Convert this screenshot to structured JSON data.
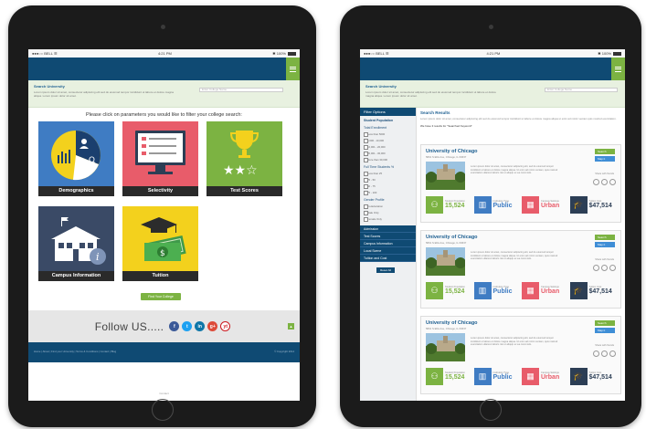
{
  "left": {
    "status": {
      "carrier": "●●●○○ BELL ☰",
      "time": "4:21 PM",
      "battery": "✱ 100%"
    },
    "search": {
      "title": "Search University",
      "desc": "Lorem ipsum dolor sit amet, consectetur adipiscing elit sed do eiusmod tempor incididunt ut labore et dolore magna aliqua. Lorem ipsum dolor sit amet.",
      "placeholder": "Enter College Name"
    },
    "instruction": "Please click on parameters you would like to filter your college search:",
    "tiles": [
      "Demographics",
      "Selectivity",
      "Test Scores",
      "Campus Information",
      "Tuition"
    ],
    "find_button": "Find Your College",
    "follow": {
      "label": "Follow US.....",
      "icons": [
        "f",
        "t",
        "in",
        "g+",
        "yt"
      ]
    },
    "footer": {
      "links": "Home | About | Find your University | Terms & Conditions | Contact | Blog",
      "copyright": "© Copyright 2014"
    },
    "page_end": "Contact"
  },
  "right": {
    "status": {
      "carrier": "●●●○○ BELL ☰",
      "time": "4:21 PM",
      "battery": "✱ 100%"
    },
    "search": {
      "title": "Search University",
      "desc": "Lorem ipsum dolor sit amet, consectetur adipiscing elit sed do eiusmod tempor incididunt ut labore et dolore magna aliqua. Lorem ipsum dolor sit amet.",
      "placeholder": "Enter College Name"
    },
    "sidebar": {
      "header": "Filter Options",
      "sections": [
        {
          "title": "Student Population",
          "options": []
        },
        {
          "title": "Total Enrollment",
          "options": [
            "Less than 5000",
            "5,000 - 10,000",
            "10,001 - 20,000",
            "20,001 - 30,000",
            "More than 30,000"
          ]
        },
        {
          "title": "Full Time Students %",
          "options": [
            "Less than 25",
            "25 - 50",
            "50 - 75",
            "75 - 100"
          ]
        },
        {
          "title": "Gender Profile",
          "options": [
            "Co-Education",
            "Male Only",
            "Female Only"
          ]
        }
      ],
      "collapsed": [
        "Admission",
        "Test Scores",
        "Campus Information",
        "Local Scene",
        "Tuition and Cost"
      ],
      "reset": "Reset All"
    },
    "results": {
      "title": "Search Results",
      "desc": "Lorem ipsum dolor sit amet, consectetur adipiscing elit sed do eiusmod tempor incididunt ut labore et dolore magna aliqua ut enim ad minim veniam quis nostrud exercitation.",
      "count": "We have 3 results for \"Searched Keyword\"",
      "cards": [
        {
          "name": "University of Chicago",
          "address": "5801 S Ellis Ave, Chicago, IL 60637",
          "desc": "Lorem ipsum dolor sit amet, consectetur adipiscing elit, sed do eiusmod tempor incididunt ut labore et dolore magna aliqua. Ut enim ad minim veniam, quis nostrud exercitation ullamco laboris nisi ut aliquip ex ea commodo.",
          "search": "Search",
          "map": "Map it",
          "share": "Share with friends",
          "stats": [
            {
              "label": "Student Population",
              "value": "15,524"
            },
            {
              "label": "Institution Type",
              "value": "Public"
            },
            {
              "label": "Campus Settings",
              "value": "Urban"
            },
            {
              "label": "Tuition Cost",
              "value": "$47,514"
            }
          ]
        },
        {
          "name": "University of Chicago",
          "address": "5801 S Ellis Ave, Chicago, IL 60637",
          "desc": "Lorem ipsum dolor sit amet, consectetur adipiscing elit, sed do eiusmod tempor incididunt ut labore et dolore magna aliqua. Ut enim ad minim veniam, quis nostrud exercitation ullamco laboris nisi ut aliquip ex ea commodo.",
          "search": "Search",
          "map": "Map it",
          "share": "Share with friends",
          "stats": [
            {
              "label": "Student Population",
              "value": "15,524"
            },
            {
              "label": "Institution Type",
              "value": "Public"
            },
            {
              "label": "Campus Settings",
              "value": "Urban"
            },
            {
              "label": "Tuition Cost",
              "value": "$47,514"
            }
          ]
        },
        {
          "name": "University of Chicago",
          "address": "5801 S Ellis Ave, Chicago, IL 60637",
          "desc": "Lorem ipsum dolor sit amet, consectetur adipiscing elit, sed do eiusmod tempor incididunt ut labore et dolore magna aliqua. Ut enim ad minim veniam, quis nostrud exercitation ullamco laboris nisi ut aliquip ex ea commodo.",
          "search": "Search",
          "map": "Map it",
          "share": "Share with friends",
          "stats": [
            {
              "label": "Student Population",
              "value": "15,524"
            },
            {
              "label": "Institution Type",
              "value": "Public"
            },
            {
              "label": "Campus Settings",
              "value": "Urban"
            },
            {
              "label": "Tuition Cost",
              "value": "$47,514"
            }
          ]
        }
      ]
    }
  },
  "colors": {
    "navy": "#0f4a73",
    "green": "#7cb342",
    "blue": "#3f7cc3",
    "red": "#e85c6a",
    "yellow": "#f3d11d",
    "slate": "#3a4a66"
  }
}
